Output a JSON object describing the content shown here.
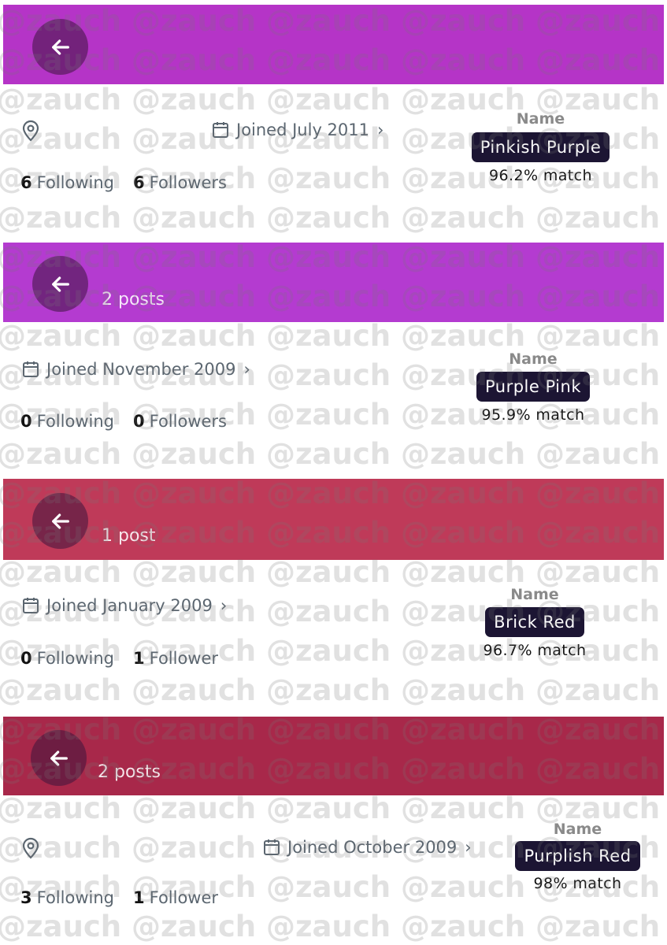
{
  "watermark": "@zauch @zauch @zauch @zauch @zauch @zauch",
  "panels": [
    {
      "header_color": "#b534c7",
      "posts": "",
      "has_location": true,
      "joined": "Joined July 2011",
      "following_count": "6",
      "following_label": "Following",
      "followers_count": "6",
      "followers_label": "Followers",
      "name_label": "Name",
      "color_name": "Pinkish Purple",
      "match": "96.2% match"
    },
    {
      "header_color": "#b43bd0",
      "posts": "2 posts",
      "has_location": false,
      "joined": "Joined November 2009",
      "following_count": "0",
      "following_label": "Following",
      "followers_count": "0",
      "followers_label": "Followers",
      "name_label": "Name",
      "color_name": "Purple Pink",
      "match": "95.9% match"
    },
    {
      "header_color": "#bf3a59",
      "posts": "1 post",
      "has_location": false,
      "joined": "Joined January 2009",
      "following_count": "0",
      "following_label": "Following",
      "followers_count": "1",
      "followers_label": "Follower",
      "name_label": "Name",
      "color_name": "Brick Red",
      "match": "96.7% match"
    },
    {
      "header_color": "#a8284a",
      "posts": "2 posts",
      "has_location": true,
      "joined": "Joined October 2009",
      "following_count": "3",
      "following_label": "Following",
      "followers_count": "1",
      "followers_label": "Follower",
      "name_label": "Name",
      "color_name": "Purplish Red",
      "match": "98% match"
    }
  ]
}
